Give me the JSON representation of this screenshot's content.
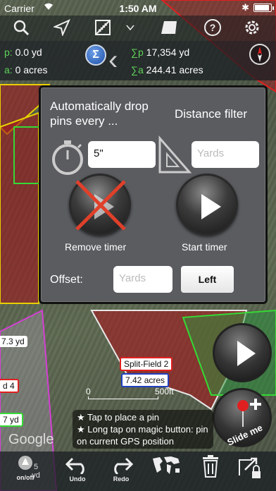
{
  "status": {
    "carrier": "Carrier",
    "time": "1:50 AM"
  },
  "measure": {
    "p_key": "p:",
    "p_val": "0.0 yd",
    "a_key": "a:",
    "a_val": "0 acres",
    "sp_key": "∑p",
    "sp_val": "17,354 yd",
    "sa_key": "∑a",
    "sa_val": "244.41 acres",
    "sigma": "Σ"
  },
  "popup": {
    "title": "Automatically drop pins every ...",
    "distance_filter": "Distance filter",
    "timer_value": "5\"",
    "yards_placeholder": "Yards",
    "remove_timer": "Remove timer",
    "start_timer": "Start timer",
    "offset_label": "Offset:",
    "offset_placeholder": "Yards",
    "left_button": "Left"
  },
  "map": {
    "field_label": "Split-Field 2",
    "area_label": "7.42 acres",
    "left_labels": [
      "7.3 yd",
      "d 4",
      "7 yd"
    ],
    "scale_zero": "0",
    "scale_end": "500ft",
    "google": "Google"
  },
  "tip": {
    "line1": "★ Tap to place a pin",
    "line2": "★ Long tap on magic button: pin on current GPS position"
  },
  "bottom": {
    "onoff": "on/off",
    "onoff_value": "5 yd",
    "undo": "Undo",
    "redo": "Redo"
  },
  "slide": "Slide me"
}
